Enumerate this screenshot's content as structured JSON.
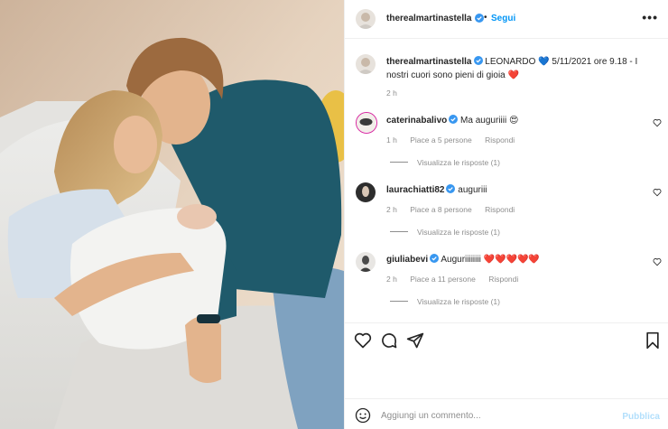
{
  "post": {
    "username": "therealmartinastella",
    "follow_label": "Segui",
    "dot": "•",
    "more_icon": "more-horizontal-icon",
    "more_glyph": "•••",
    "photo_alt": "photo"
  },
  "caption": {
    "username": "therealmartinastella",
    "text": " LEONARDO 💙 5/11/2021 ore 9.18 - I nostri cuori sono pieni di gioia ❤️",
    "time": "2 h"
  },
  "comments": [
    {
      "username": "caterinabalivo",
      "text": "Ma auguriiii 😍",
      "time": "1 h",
      "likes": "Piace a 5 persone",
      "reply_label": "Rispondi",
      "view_replies": "Visualizza le risposte (1)"
    },
    {
      "username": "laurachiatti82",
      "text": "auguriii",
      "time": "2 h",
      "likes": "Piace a 8 persone",
      "reply_label": "Rispondi",
      "view_replies": "Visualizza le risposte (1)"
    },
    {
      "username": "giuliabevi",
      "text": "Auguriiiiiiii ❤️❤️❤️❤️❤️",
      "time": "2 h",
      "likes": "Piace a 11 persone",
      "reply_label": "Rispondi",
      "view_replies": "Visualizza le risposte (1)"
    }
  ],
  "actions": {
    "icons": [
      "heart-icon",
      "comment-icon",
      "share-icon",
      "bookmark-icon"
    ]
  },
  "add_comment": {
    "placeholder": "Aggiungi un commento...",
    "publish_label": "Pubblica"
  },
  "colors": {
    "link_blue": "#0095f6",
    "publish_disabled": "#b2dffc",
    "muted": "#8e8e8e",
    "text": "#262626",
    "border": "#efefef"
  }
}
